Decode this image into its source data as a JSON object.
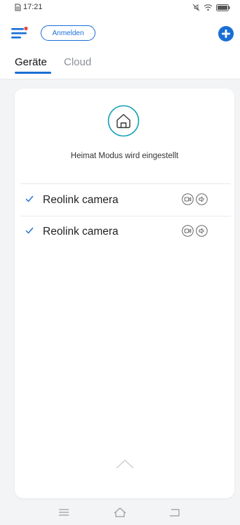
{
  "status_bar": {
    "time": "17:21",
    "icons": [
      "sim-card-icon",
      "mute-icon",
      "wifi-icon",
      "battery-icon"
    ]
  },
  "header": {
    "menu_icon": "menu-icon",
    "login_label": "Anmelden",
    "add_icon": "add-circle-icon",
    "accent_color": "#1a6fd6",
    "notification_dot_color": "#e8473f"
  },
  "tabs": [
    {
      "label": "Geräte",
      "active": true
    },
    {
      "label": "Cloud",
      "active": false
    }
  ],
  "card": {
    "mode_icon": "home-icon",
    "mode_icon_color": "#17a2b8",
    "mode_text": "Heimat Modus wird eingestellt",
    "cameras": [
      {
        "name": "Reolink camera",
        "checked": true,
        "icons": [
          "video-record-icon",
          "audio-icon"
        ]
      },
      {
        "name": "Reolink camera",
        "checked": true,
        "icons": [
          "video-record-icon",
          "audio-icon"
        ]
      }
    ],
    "expand_icon": "chevron-up-icon"
  },
  "nav_bar": {
    "icons": [
      "menu-lines-icon",
      "home-outline-icon",
      "back-icon"
    ]
  }
}
